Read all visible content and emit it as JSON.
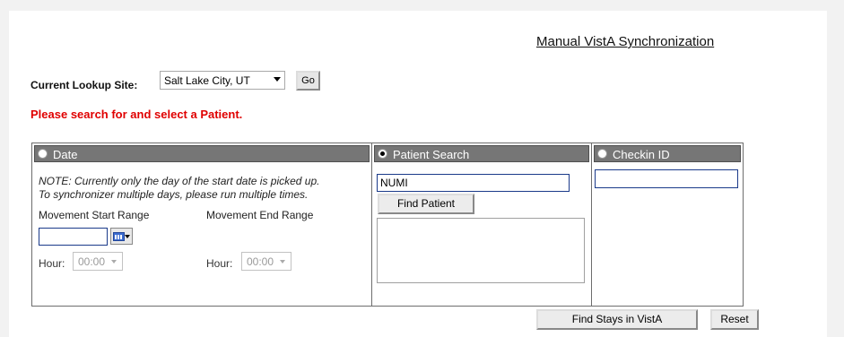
{
  "page_title": "Manual VistA Synchronization",
  "lookup": {
    "label": "Current Lookup Site:",
    "selected_site": "Salt Lake City, UT",
    "go_label": "Go"
  },
  "alert": "Please search for and select a Patient.",
  "date_section": {
    "header": "Date",
    "selected": false,
    "note_line1": "NOTE: Currently only the day of the start date is picked up.",
    "note_line2": "To synchronizer multiple days, please run multiple times.",
    "start_label": "Movement Start Range",
    "end_label": "Movement End Range",
    "start_date_value": "",
    "start_hour_label": "Hour:",
    "start_hour_value": "00:00",
    "end_hour_label": "Hour:",
    "end_hour_value": "00:00"
  },
  "patient_section": {
    "header": "Patient Search",
    "selected": true,
    "search_value": "NUMI",
    "find_label": "Find Patient",
    "results": []
  },
  "checkin_section": {
    "header": "Checkin ID",
    "selected": false,
    "checkin_value": ""
  },
  "actions": {
    "find_stays_label": "Find Stays in VistA",
    "reset_label": "Reset"
  },
  "colors": {
    "header_bg": "#767676",
    "alert": "#e00000",
    "input_border": "#1a3a8a"
  }
}
